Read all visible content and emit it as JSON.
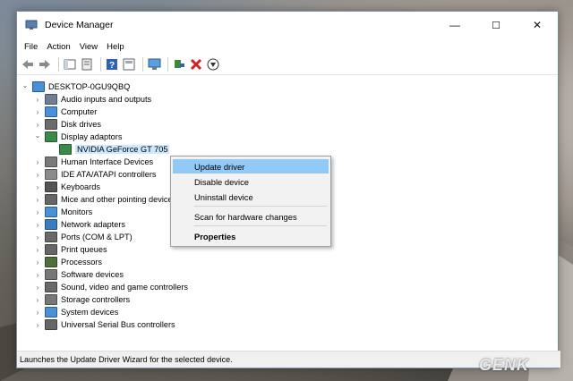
{
  "window": {
    "title": "Device Manager"
  },
  "window_controls": [
    "—",
    "☐",
    "✕"
  ],
  "menu": [
    "File",
    "Action",
    "View",
    "Help"
  ],
  "toolbar": [
    "back-icon",
    "forward-icon",
    "show-hide-icon",
    "properties-icon",
    "help-icon",
    "computer-monitor-icon",
    "update-driver-icon",
    "uninstall-icon",
    "scan-download-icon"
  ],
  "tree": {
    "root": "DESKTOP-0GU9QBQ",
    "categories": [
      {
        "label": "Audio inputs and outputs",
        "icon": "speaker-icon",
        "color": "#6f7f92"
      },
      {
        "label": "Computer",
        "icon": "computer-icon",
        "color": "#4a90d9"
      },
      {
        "label": "Disk drives",
        "icon": "disk-drive-icon",
        "color": "#6b6b6b"
      },
      {
        "label": "Display adaptors",
        "icon": "display-adapter-icon",
        "color": "#3c8a4a",
        "expanded": true
      },
      {
        "label": "Human Interface Devices",
        "icon": "hid-icon",
        "color": "#7a7a7a"
      },
      {
        "label": "IDE ATA/ATAPI controllers",
        "icon": "ide-controller-icon",
        "color": "#8a8a8a"
      },
      {
        "label": "Keyboards",
        "icon": "keyboard-icon",
        "color": "#555555"
      },
      {
        "label": "Mice and other pointing devices",
        "icon": "mouse-icon",
        "color": "#666666"
      },
      {
        "label": "Monitors",
        "icon": "monitor-icon",
        "color": "#4a90d9"
      },
      {
        "label": "Network adapters",
        "icon": "network-adapter-icon",
        "color": "#3a7cc0"
      },
      {
        "label": "Ports (COM & LPT)",
        "icon": "port-icon",
        "color": "#6a6a6a"
      },
      {
        "label": "Print queues",
        "icon": "printer-icon",
        "color": "#666666"
      },
      {
        "label": "Processors",
        "icon": "processor-icon",
        "color": "#4f6f3a"
      },
      {
        "label": "Software devices",
        "icon": "software-device-icon",
        "color": "#777777"
      },
      {
        "label": "Sound, video and game controllers",
        "icon": "sound-icon",
        "color": "#6a6a6a"
      },
      {
        "label": "Storage controllers",
        "icon": "storage-controller-icon",
        "color": "#777777"
      },
      {
        "label": "System devices",
        "icon": "system-device-icon",
        "color": "#4a90d9"
      },
      {
        "label": "Universal Serial Bus controllers",
        "icon": "usb-icon",
        "color": "#666666"
      }
    ],
    "child_device": "NVIDIA GeForce GT 705"
  },
  "context_menu": {
    "items": [
      "Update driver",
      "Disable device",
      "Uninstall device",
      "Scan for hardware changes",
      "Properties"
    ]
  },
  "status": "Launches the Update Driver Wizard for the selected device.",
  "watermark": "GENK"
}
